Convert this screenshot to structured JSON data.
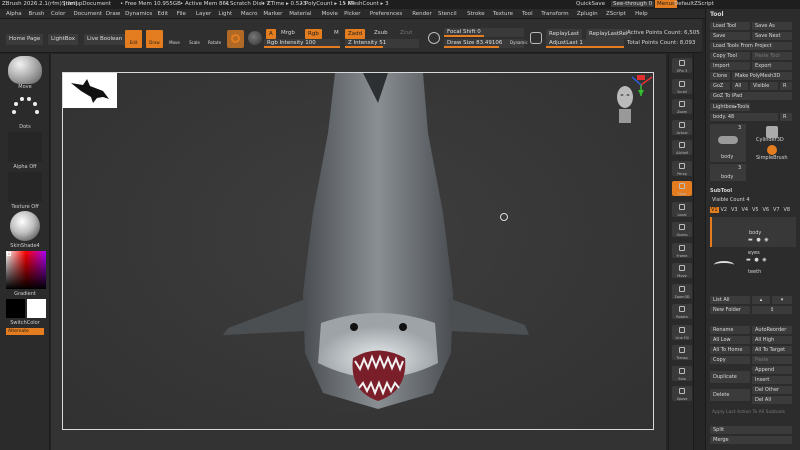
{
  "titlebar": {
    "app": "ZBrush 2026.2.1(rfm) [rfm]",
    "document": "StartupDocument",
    "free_mem": "• Free Mem 10.955GB",
    "active_mem": "• Active Mem 861",
    "scratch": "• Scratch Disk 7",
    "ztime": "• ZTime ▸ 0.523",
    "polycount": "• PolyCount ▸ 15 KP",
    "meshcount": "• MeshCount ▸ 3",
    "quicksave": "QuickSave",
    "see_through": "See-through 0",
    "menus": "Menus",
    "script": "DefaultZScript"
  },
  "menubar": [
    "Alpha",
    "Brush",
    "Color",
    "Document",
    "Draw",
    "Dynamics",
    "Edit",
    "File",
    "Layer",
    "Light",
    "Macro",
    "Marker",
    "Material",
    "Movie",
    "Picker",
    "Preferences",
    "Render",
    "Stencil",
    "Stroke",
    "Texture",
    "Tool",
    "Transform",
    "Zplugin",
    "ZScript",
    "Help"
  ],
  "toolbar": {
    "home_page": "Home Page",
    "lightbox": "LightBox",
    "live_boolean": "Live Boolean",
    "edit": "Edit",
    "draw": "Draw",
    "move": "Move",
    "scale": "Scale",
    "rotate": "Rotate",
    "a_btn": "A",
    "mrgb": "Mrgb",
    "rgb": "Rgb",
    "m": "M",
    "zadd": "Zadd",
    "zsub": "Zsub",
    "zcut": "Zcut",
    "rgb_intensity": "Rgb Intensity 100",
    "z_intensity": "Z Intensity 51",
    "focal_shift": "Focal Shift 0",
    "draw_size": "Draw Size 83.49106",
    "dynamic": "Dynamic",
    "replay_last": "ReplayLast",
    "replay_last_rel": "ReplayLastRel",
    "adjust_last": "AdjustLast 1",
    "active_points": "Active Points Count: 6,505",
    "total_points": "Total Points Count: 8,093"
  },
  "leftshelf": {
    "brush": "Move",
    "stroke": "Dots",
    "alpha": "Alpha Off",
    "texture": "Texture Off",
    "material": "SkinShade4",
    "gradient": "Gradient",
    "switch_color": "SwitchColor",
    "alternate": "Alternate"
  },
  "rightshelf": [
    "SPix 3",
    "Scroll",
    "Zoom",
    "Actual",
    "AAHalf",
    "Persp",
    "Floor",
    "Local",
    "Gizmo",
    "Frame",
    "Move",
    "Zoom3D",
    "Rotate",
    "Line Fill",
    "Transp",
    "Solo",
    "Xpose"
  ],
  "toolpanel": {
    "title": "Tool",
    "load_tool": "Load Tool",
    "save_as": "Save As",
    "save": "Save",
    "save_next": "Save Next",
    "load_from_project": "Load Tools From Project",
    "copy_tool": "Copy Tool",
    "paste_tool": "Paste Tool",
    "import": "Import",
    "export": "Export",
    "clone": "Clone",
    "make_polymesh": "Make PolyMesh3D",
    "goz": "GoZ",
    "all": "All",
    "visible": "Visible",
    "r": "R",
    "goz_ipad": "GoZ To iPad",
    "lightbox_tools": "Lightbox▸Tools",
    "tool_name": "body. 48",
    "r2": "R",
    "thumb_count1": "3",
    "thumb_label1": "body",
    "cylinder": "Cylinder3D",
    "simplebrush": "SimpleBrush",
    "thumb_count2": "3",
    "thumb_label2": "body",
    "subtool_title": "SubTool",
    "visible_count": "Visible Count 4",
    "versions": [
      "V1",
      "V2",
      "V3",
      "V4",
      "V5",
      "V6",
      "V7",
      "V8"
    ],
    "subtools": [
      "body",
      "eyes",
      "teeth"
    ],
    "list_all": "List All",
    "new_folder": "New Folder",
    "rename": "Rename",
    "auto_reorder": "AutoReorder",
    "all_low": "All Low",
    "all_high": "All High",
    "all_to_home": "All To Home",
    "all_to_target": "All To Target",
    "copy": "Copy",
    "paste": "Paste",
    "append": "Append",
    "duplicate": "Duplicate",
    "insert": "Insert",
    "delete": "Delete",
    "del_other": "Del Other",
    "del_all": "Del All",
    "apply_last": "Apply Last Action To All Subtools",
    "split": "Split",
    "merge": "Merge"
  },
  "colors": {
    "accent": "#e47d1f",
    "background": "#262626",
    "canvas": "#363636"
  }
}
